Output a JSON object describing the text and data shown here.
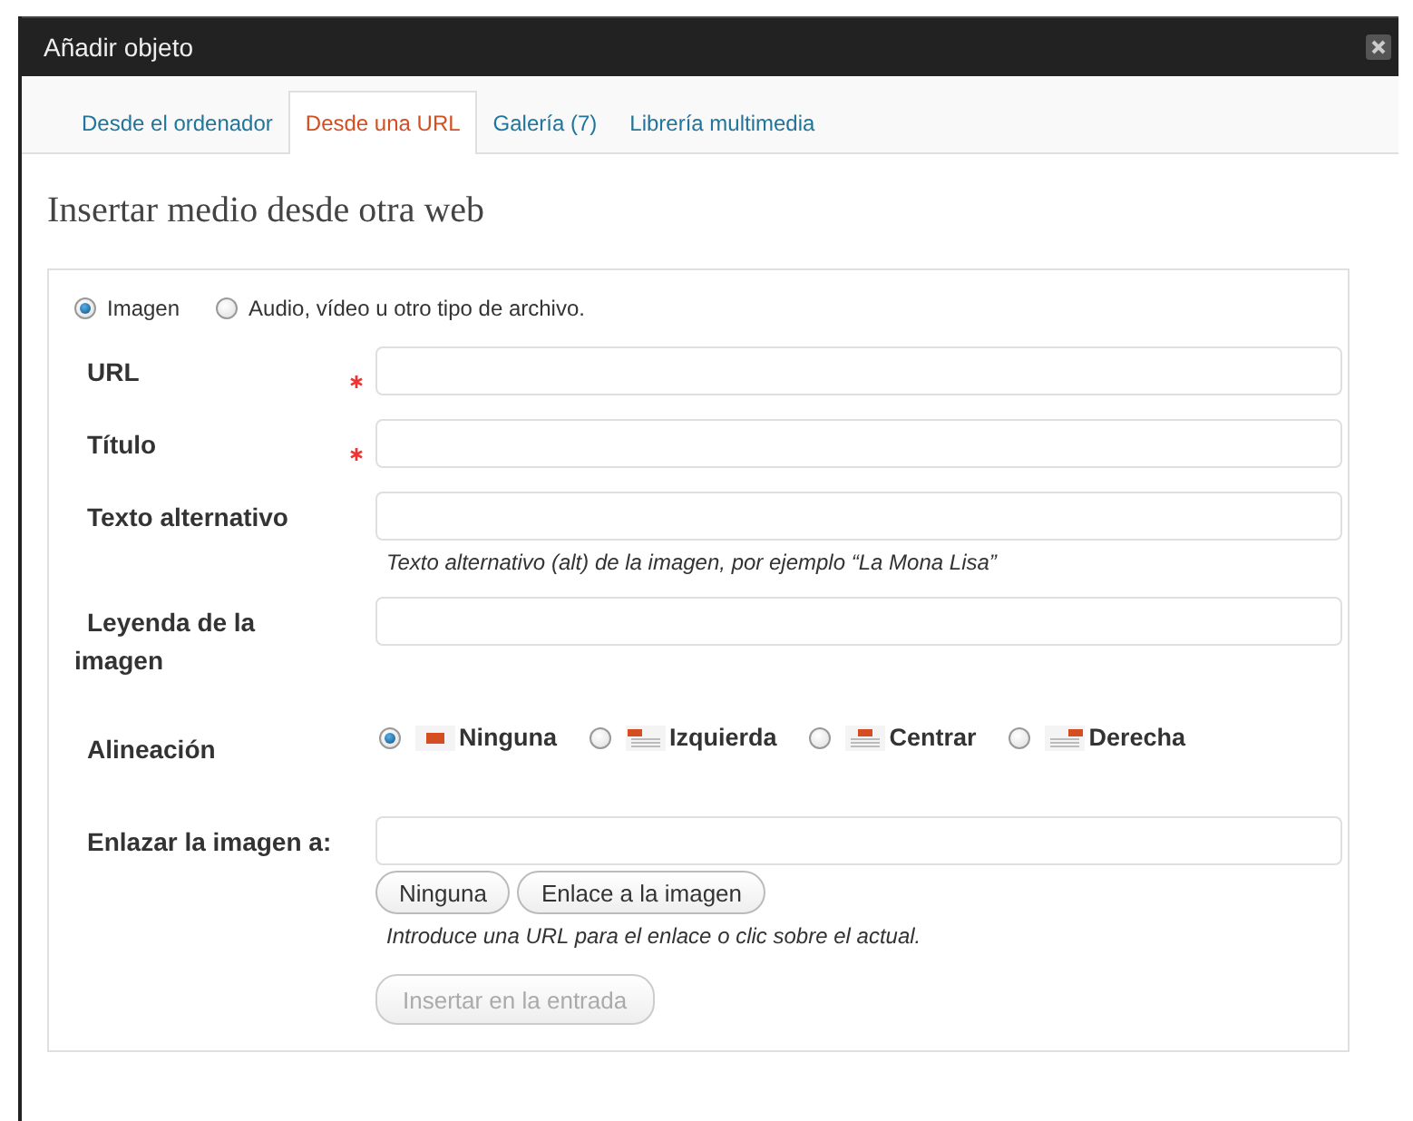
{
  "window": {
    "title": "Añadir objeto"
  },
  "tabs": [
    {
      "label": "Desde el ordenador",
      "selected": false
    },
    {
      "label": "Desde una URL",
      "selected": true
    },
    {
      "label": "Galería (7)",
      "selected": false
    },
    {
      "label": "Librería multimedia",
      "selected": false
    }
  ],
  "heading": "Insertar medio desde otra web",
  "media_type": [
    {
      "label": "Imagen",
      "selected": true
    },
    {
      "label": "Audio, vídeo u otro tipo de archivo.",
      "selected": false
    }
  ],
  "fields": [
    {
      "label": "URL",
      "required": true
    },
    {
      "label": "Título",
      "required": true
    },
    {
      "label": "Texto alternativo",
      "required": false,
      "hint": "Texto alternativo (alt) de la imagen, por ejemplo “La Mona Lisa”"
    },
    {
      "label": "Leyenda de la imagen",
      "required": false
    }
  ],
  "alignment": {
    "label": "Alineación",
    "options": [
      {
        "kind": "none",
        "label": "Ninguna",
        "selected": true
      },
      {
        "kind": "left",
        "label": "Izquierda",
        "selected": false
      },
      {
        "kind": "center",
        "label": "Centrar",
        "selected": false
      },
      {
        "kind": "right",
        "label": "Derecha",
        "selected": false
      }
    ]
  },
  "link": {
    "label": "Enlazar la imagen a:",
    "buttons": [
      "Ninguna",
      "Enlace a la imagen"
    ],
    "hint": "Introduce una URL para el enlace o clic sobre el actual."
  },
  "submit": {
    "label": "Insertar en la entrada",
    "disabled": true
  }
}
